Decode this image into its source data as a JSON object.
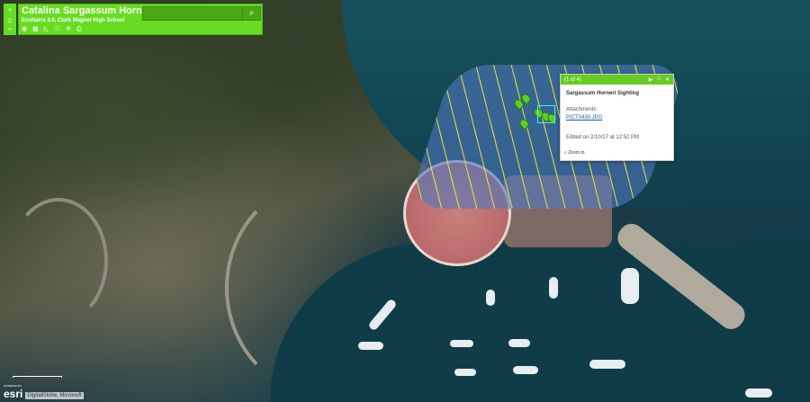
{
  "header": {
    "title": "Catalina Sargassum Horneri Survey",
    "subtitle": "EcoNarra 3.0, Clark Magnet High School",
    "search_placeholder": "",
    "search_icon": "search-icon"
  },
  "zoom": {
    "in": "+",
    "home": "⌂",
    "out": "−"
  },
  "tools": [
    {
      "name": "layers-icon",
      "glyph": "◉"
    },
    {
      "name": "basemap-icon",
      "glyph": "▦"
    },
    {
      "name": "measure-icon",
      "glyph": "◺"
    },
    {
      "name": "info-icon",
      "glyph": "ⓘ"
    },
    {
      "name": "locate-icon",
      "glyph": "✥"
    },
    {
      "name": "print-icon",
      "glyph": "⎙"
    }
  ],
  "popup": {
    "counter": "(1 of 4)",
    "title": "Sargassum Horneri Sighting",
    "attachments_label": "Attachments:",
    "attachment": "PICT0430.JPG",
    "edited": "Edited on 2/10/17 at 12:52 PM",
    "zoom_to": "Zoom to",
    "next": "▶",
    "maximize": "□",
    "close": "✕"
  },
  "attribution": {
    "powered_by": "POWERED BY",
    "logo": "esri",
    "credits": "DigitalGlobe, Microsoft"
  },
  "colors": {
    "accent": "#66dd22",
    "feature": "#5ccf25",
    "link": "#1a5ea8"
  }
}
